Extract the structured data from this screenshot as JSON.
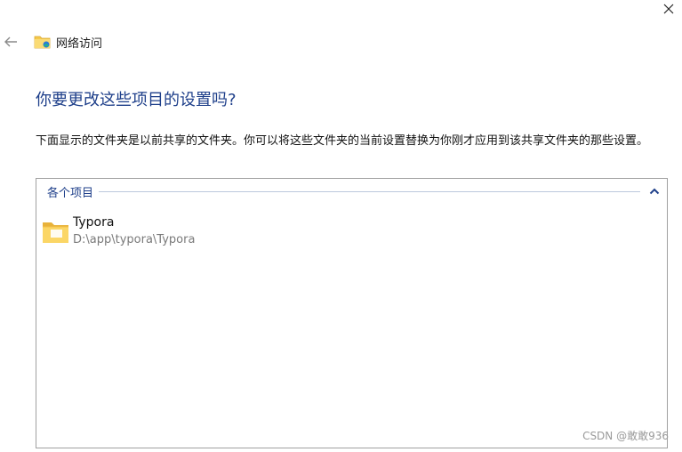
{
  "window": {
    "title": "网络访问",
    "close_icon": "close-icon",
    "back_icon": "back-arrow-icon",
    "title_icon": "network-folder-icon"
  },
  "main": {
    "heading": "你要更改这些项目的设置吗?",
    "description": "下面显示的文件夹是以前共享的文件夹。你可以将这些文件夹的当前设置替换为你刚才应用到该共享文件夹的那些设置。"
  },
  "items_group": {
    "label": "各个项目",
    "collapse_icon": "chevron-up-icon",
    "items": [
      {
        "name": "Typora",
        "path": "D:\\app\\typora\\Typora",
        "icon": "folder-icon"
      }
    ]
  },
  "watermark": "CSDN @敢敢936",
  "colors": {
    "heading": "#1e3f8a",
    "group_line": "#bcc8dc",
    "path_text": "#7a7a7a",
    "folder_yellow": "#f5c94c"
  }
}
